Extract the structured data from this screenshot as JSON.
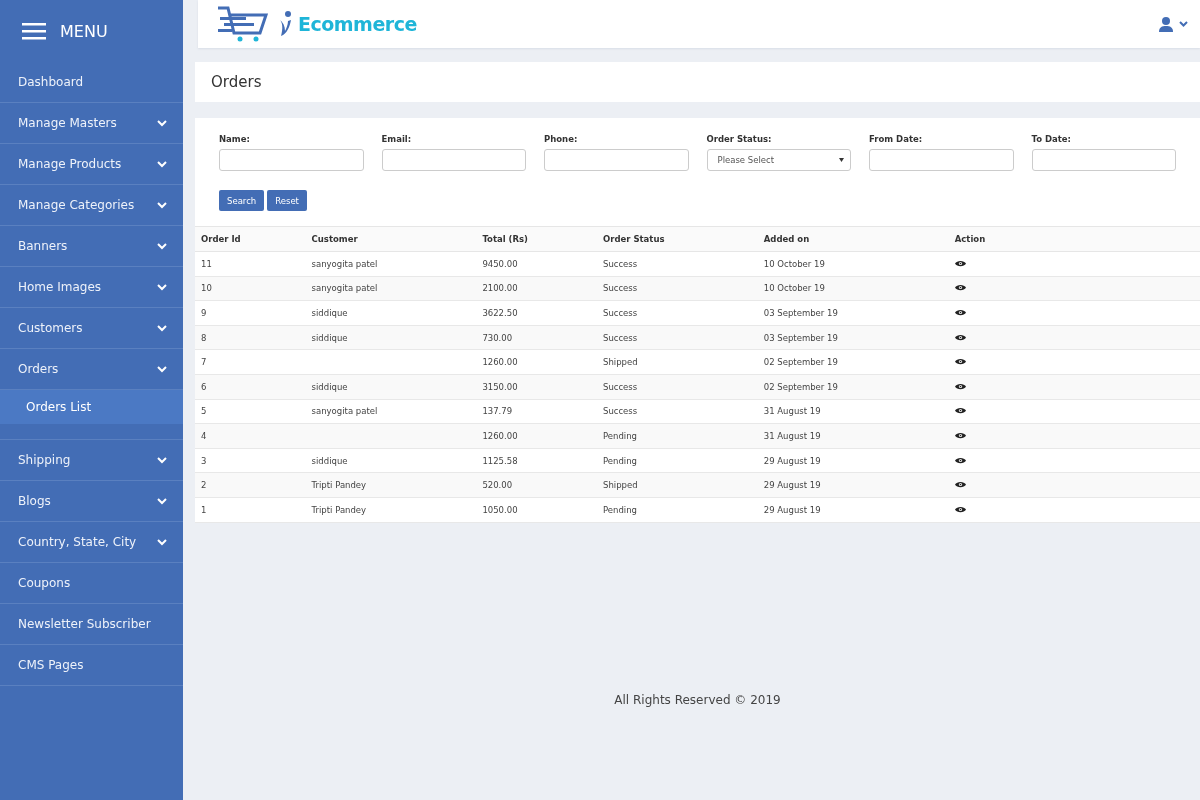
{
  "sidebar": {
    "title": "MENU",
    "items": [
      {
        "label": "Dashboard",
        "kind": "link"
      },
      {
        "label": "Manage Masters",
        "kind": "submenu"
      },
      {
        "label": "Manage Products",
        "kind": "submenu"
      },
      {
        "label": "Manage Categories",
        "kind": "submenu"
      },
      {
        "label": "Banners",
        "kind": "submenu"
      },
      {
        "label": "Home Images",
        "kind": "submenu"
      },
      {
        "label": "Customers",
        "kind": "submenu"
      },
      {
        "label": "Orders",
        "kind": "submenu",
        "children": [
          {
            "label": "Orders List",
            "selected": true
          }
        ]
      },
      {
        "label": "Shipping",
        "kind": "submenu"
      },
      {
        "label": "Blogs",
        "kind": "submenu"
      },
      {
        "label": "Country, State, City",
        "kind": "submenu"
      },
      {
        "label": "Coupons",
        "kind": "link"
      },
      {
        "label": "Newsletter Subscriber",
        "kind": "link"
      },
      {
        "label": "CMS Pages",
        "kind": "link"
      }
    ]
  },
  "header": {
    "logo_text": "Ecommerce"
  },
  "page_title": "Orders",
  "filters": [
    {
      "label": "Name:",
      "kind": "text"
    },
    {
      "label": "Email:",
      "kind": "text"
    },
    {
      "label": "Phone:",
      "kind": "text"
    },
    {
      "label": "Order Status:",
      "kind": "select",
      "value": "Please Select"
    },
    {
      "label": "From Date:",
      "kind": "text"
    },
    {
      "label": "To Date:",
      "kind": "text"
    }
  ],
  "buttons": [
    "Search",
    "Reset"
  ],
  "table": {
    "columns": [
      "Order Id",
      "Customer",
      "Total (Rs)",
      "Order Status",
      "Added on",
      "Action"
    ],
    "rows": [
      [
        "11",
        "sanyogita patel",
        "9450.00",
        "Success",
        "10 October 19"
      ],
      [
        "10",
        "sanyogita patel",
        "2100.00",
        "Success",
        "10 October 19"
      ],
      [
        "9",
        "siddique",
        "3622.50",
        "Success",
        "03 September 19"
      ],
      [
        "8",
        "siddique",
        "730.00",
        "Success",
        "03 September 19"
      ],
      [
        "7",
        "",
        "1260.00",
        "Shipped",
        "02 September 19"
      ],
      [
        "6",
        "siddique",
        "3150.00",
        "Success",
        "02 September 19"
      ],
      [
        "5",
        "sanyogita patel",
        "137.79",
        "Success",
        "31 August 19"
      ],
      [
        "4",
        "",
        "1260.00",
        "Pending",
        "31 August 19"
      ],
      [
        "3",
        "siddique",
        "1125.58",
        "Pending",
        "29 August 19"
      ],
      [
        "2",
        "Tripti Pandey",
        "520.00",
        "Shipped",
        "29 August 19"
      ],
      [
        "1",
        "Tripti Pandey",
        "1050.00",
        "Pending",
        "29 August 19"
      ]
    ]
  },
  "footer": "All Rights Reserved © 2019"
}
